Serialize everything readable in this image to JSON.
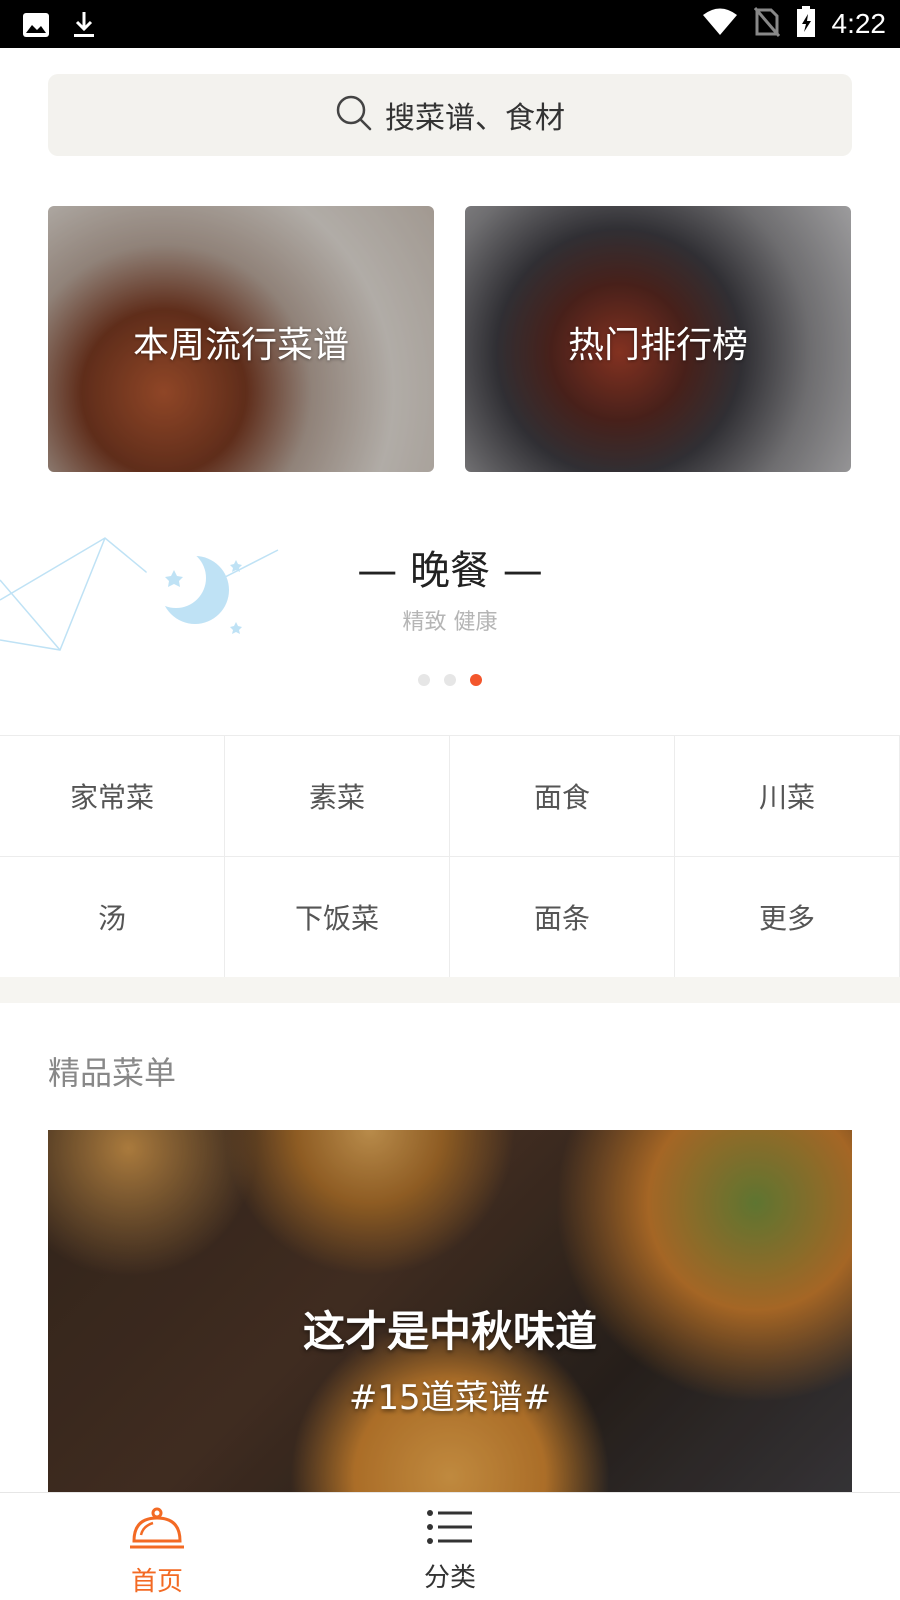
{
  "status_bar": {
    "time": "4:22"
  },
  "search": {
    "placeholder": "搜菜谱、食材"
  },
  "feature_cards": [
    {
      "title": "本周流行菜谱"
    },
    {
      "title": "热门排行榜"
    }
  ],
  "meal_banner": {
    "title": "— 晚餐 —",
    "subtitle": "精致 健康",
    "active_dot": 3,
    "dot_count": 3
  },
  "categories": [
    {
      "label": "家常菜"
    },
    {
      "label": "素菜"
    },
    {
      "label": "面食"
    },
    {
      "label": "川菜"
    },
    {
      "label": "汤"
    },
    {
      "label": "下饭菜"
    },
    {
      "label": "面条"
    },
    {
      "label": "更多"
    }
  ],
  "section": {
    "title": "精品菜单"
  },
  "menu_banner": {
    "title": "这才是中秋味道",
    "subtitle": "#15道菜谱#"
  },
  "bottom_nav": [
    {
      "label": "首页",
      "active": true
    },
    {
      "label": "分类",
      "active": false
    }
  ],
  "colors": {
    "accent": "#f36a24",
    "active_dot": "#f3562c",
    "search_bg": "#f3f2ee"
  }
}
